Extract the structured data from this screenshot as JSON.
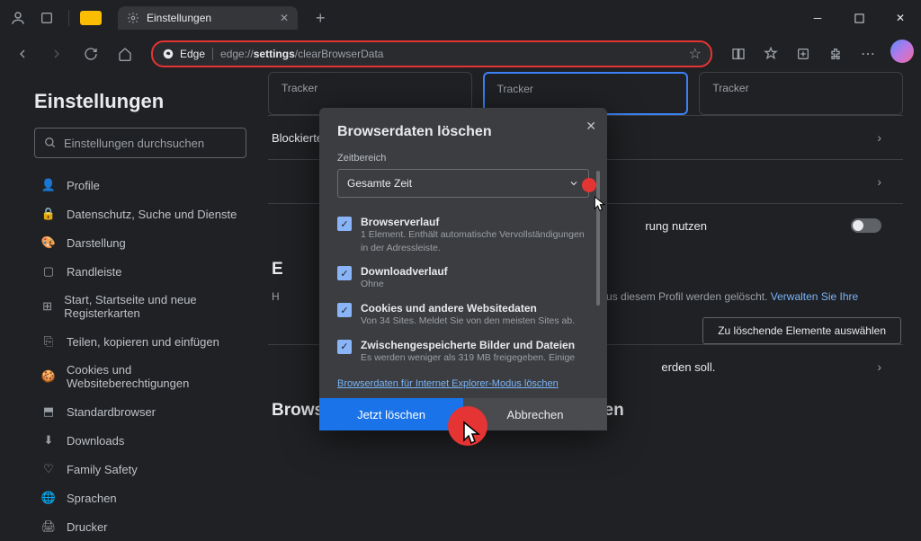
{
  "titlebar": {
    "tab_title": "Einstellungen"
  },
  "toolbar": {
    "addr_prefix": "Edge",
    "addr_pre": "edge://",
    "addr_bold": "settings",
    "addr_post": "/clearBrowserData"
  },
  "sidebar": {
    "title": "Einstellungen",
    "search_placeholder": "Einstellungen durchsuchen",
    "items": [
      {
        "label": "Profile"
      },
      {
        "label": "Datenschutz, Suche und Dienste"
      },
      {
        "label": "Darstellung"
      },
      {
        "label": "Randleiste"
      },
      {
        "label": "Start, Startseite und neue Registerkarten"
      },
      {
        "label": "Teilen, kopieren und einfügen"
      },
      {
        "label": "Cookies und Websiteberechtigungen"
      },
      {
        "label": "Standardbrowser"
      },
      {
        "label": "Downloads"
      },
      {
        "label": "Family Safety"
      },
      {
        "label": "Sprachen"
      },
      {
        "label": "Drucker"
      }
    ]
  },
  "content": {
    "tracker_label": "Tracker",
    "blocked_trackers": "Blockierte Tracker",
    "strict_row": "rung nutzen",
    "section_e": "E",
    "section_h": "H",
    "profile_text": "us diesem Profil werden gelöscht.",
    "profile_link": "Verwalten Sie Ihre",
    "choose_btn": "Zu löschende Elemente auswählen",
    "closed_row": "erden soll.",
    "ie_title": "Browserdaten für Internet Explorer löschen"
  },
  "dialog": {
    "title": "Browserdaten löschen",
    "time_label": "Zeitbereich",
    "time_value": "Gesamte Zeit",
    "items": [
      {
        "title": "Browserverlauf",
        "desc": "1 Element. Enthält automatische Vervollständigungen in der Adressleiste."
      },
      {
        "title": "Downloadverlauf",
        "desc": "Ohne"
      },
      {
        "title": "Cookies und andere Websitedaten",
        "desc": "Von 34 Sites. Meldet Sie von den meisten Sites ab."
      },
      {
        "title": "Zwischengespeicherte Bilder und Dateien",
        "desc": "Es werden weniger als 319 MB freigegeben. Einige"
      }
    ],
    "ie_link": "Browserdaten für Internet Explorer-Modus löschen",
    "primary": "Jetzt löschen",
    "secondary": "Abbrechen"
  }
}
